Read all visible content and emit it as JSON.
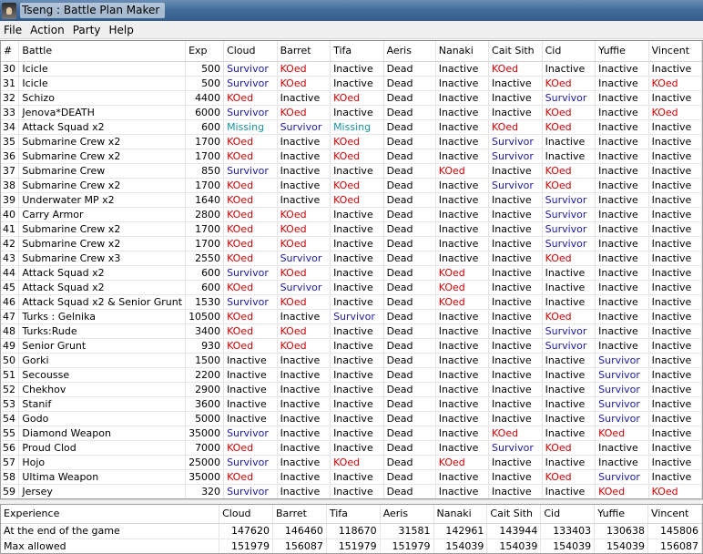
{
  "window": {
    "title": "Tseng : Battle Plan Maker"
  },
  "menu": [
    "File",
    "Action",
    "Party",
    "Help"
  ],
  "battle_grid": {
    "headers": [
      "#",
      "Battle",
      "Exp",
      "Cloud",
      "Barret",
      "Tifa",
      "Aeris",
      "Nanaki",
      "Cait Sith",
      "Cid",
      "Yuffie",
      "Vincent"
    ],
    "rows": [
      [
        "30",
        "Icicle",
        "500",
        "Survivor",
        "KOed",
        "Inactive",
        "Dead",
        "Inactive",
        "KOed",
        "Inactive",
        "Inactive",
        "Inactive"
      ],
      [
        "31",
        "Icicle",
        "500",
        "Survivor",
        "KOed",
        "Inactive",
        "Dead",
        "Inactive",
        "Inactive",
        "KOed",
        "Inactive",
        "KOed"
      ],
      [
        "32",
        "Schizo",
        "4400",
        "KOed",
        "Inactive",
        "KOed",
        "Dead",
        "Inactive",
        "Inactive",
        "Survivor",
        "Inactive",
        "Inactive"
      ],
      [
        "33",
        "Jenova*DEATH",
        "6000",
        "Survivor",
        "KOed",
        "Inactive",
        "Dead",
        "Inactive",
        "Inactive",
        "KOed",
        "Inactive",
        "KOed"
      ],
      [
        "34",
        "Attack Squad x2",
        "600",
        "Missing",
        "Survivor",
        "Missing",
        "Dead",
        "Inactive",
        "KOed",
        "KOed",
        "Inactive",
        "Inactive"
      ],
      [
        "35",
        "Submarine Crew x2",
        "1700",
        "KOed",
        "Inactive",
        "KOed",
        "Dead",
        "Inactive",
        "Survivor",
        "Inactive",
        "Inactive",
        "Inactive"
      ],
      [
        "36",
        "Submarine Crew x2",
        "1700",
        "KOed",
        "Inactive",
        "KOed",
        "Dead",
        "Inactive",
        "Survivor",
        "Inactive",
        "Inactive",
        "Inactive"
      ],
      [
        "37",
        "Submarine Crew",
        "850",
        "Survivor",
        "Inactive",
        "Inactive",
        "Dead",
        "KOed",
        "Inactive",
        "KOed",
        "Inactive",
        "Inactive"
      ],
      [
        "38",
        "Submarine Crew x2",
        "1700",
        "KOed",
        "Inactive",
        "KOed",
        "Dead",
        "Inactive",
        "Survivor",
        "KOed",
        "Inactive",
        "Inactive"
      ],
      [
        "39",
        "Underwater MP x2",
        "1640",
        "KOed",
        "Inactive",
        "KOed",
        "Dead",
        "Inactive",
        "Inactive",
        "Survivor",
        "Inactive",
        "Inactive"
      ],
      [
        "40",
        "Carry Armor",
        "2800",
        "KOed",
        "KOed",
        "Inactive",
        "Dead",
        "Inactive",
        "Inactive",
        "Survivor",
        "Inactive",
        "Inactive"
      ],
      [
        "41",
        "Submarine Crew x2",
        "1700",
        "KOed",
        "KOed",
        "Inactive",
        "Dead",
        "Inactive",
        "Inactive",
        "Survivor",
        "Inactive",
        "Inactive"
      ],
      [
        "42",
        "Submarine Crew x2",
        "1700",
        "KOed",
        "KOed",
        "Inactive",
        "Dead",
        "Inactive",
        "Inactive",
        "Survivor",
        "Inactive",
        "Inactive"
      ],
      [
        "43",
        "Submarine Crew x3",
        "2550",
        "KOed",
        "Survivor",
        "Inactive",
        "Dead",
        "Inactive",
        "Inactive",
        "KOed",
        "Inactive",
        "Inactive"
      ],
      [
        "44",
        "Attack Squad x2",
        "600",
        "Survivor",
        "KOed",
        "Inactive",
        "Dead",
        "KOed",
        "Inactive",
        "Inactive",
        "Inactive",
        "Inactive"
      ],
      [
        "45",
        "Attack Squad x2",
        "600",
        "KOed",
        "Survivor",
        "Inactive",
        "Dead",
        "KOed",
        "Inactive",
        "Inactive",
        "Inactive",
        "Inactive"
      ],
      [
        "46",
        "Attack Squad x2 & Senior Grunt",
        "1530",
        "Survivor",
        "KOed",
        "Inactive",
        "Dead",
        "KOed",
        "Inactive",
        "Inactive",
        "Inactive",
        "Inactive"
      ],
      [
        "47",
        "Turks : Gelnika",
        "10500",
        "KOed",
        "Inactive",
        "Survivor",
        "Dead",
        "Inactive",
        "Inactive",
        "KOed",
        "Inactive",
        "Inactive"
      ],
      [
        "48",
        "Turks:Rude",
        "3400",
        "KOed",
        "KOed",
        "Inactive",
        "Dead",
        "Inactive",
        "Inactive",
        "Survivor",
        "Inactive",
        "Inactive"
      ],
      [
        "49",
        "Senior Grunt",
        "930",
        "KOed",
        "KOed",
        "Inactive",
        "Dead",
        "Inactive",
        "Inactive",
        "Survivor",
        "Inactive",
        "Inactive"
      ],
      [
        "50",
        "Gorki",
        "1500",
        "Inactive",
        "Inactive",
        "Inactive",
        "Dead",
        "Inactive",
        "Inactive",
        "Inactive",
        "Survivor",
        "Inactive"
      ],
      [
        "51",
        "Secousse",
        "2200",
        "Inactive",
        "Inactive",
        "Inactive",
        "Dead",
        "Inactive",
        "Inactive",
        "Inactive",
        "Survivor",
        "Inactive"
      ],
      [
        "52",
        "Chekhov",
        "2900",
        "Inactive",
        "Inactive",
        "Inactive",
        "Dead",
        "Inactive",
        "Inactive",
        "Inactive",
        "Survivor",
        "Inactive"
      ],
      [
        "53",
        "Stanif",
        "3600",
        "Inactive",
        "Inactive",
        "Inactive",
        "Dead",
        "Inactive",
        "Inactive",
        "Inactive",
        "Survivor",
        "Inactive"
      ],
      [
        "54",
        "Godo",
        "5000",
        "Inactive",
        "Inactive",
        "Inactive",
        "Dead",
        "Inactive",
        "Inactive",
        "Inactive",
        "Survivor",
        "Inactive"
      ],
      [
        "55",
        "Diamond Weapon",
        "35000",
        "Survivor",
        "Inactive",
        "Inactive",
        "Dead",
        "Inactive",
        "KOed",
        "Inactive",
        "KOed",
        "Inactive"
      ],
      [
        "56",
        "Proud Clod",
        "7000",
        "KOed",
        "Inactive",
        "Inactive",
        "Dead",
        "Inactive",
        "Survivor",
        "KOed",
        "Inactive",
        "Inactive"
      ],
      [
        "57",
        "Hojo",
        "25000",
        "Survivor",
        "Inactive",
        "KOed",
        "Dead",
        "KOed",
        "Inactive",
        "Inactive",
        "Inactive",
        "Inactive"
      ],
      [
        "58",
        "Ultima Weapon",
        "35000",
        "KOed",
        "Inactive",
        "Inactive",
        "Dead",
        "Inactive",
        "Inactive",
        "KOed",
        "Survivor",
        "Inactive"
      ],
      [
        "59",
        "Jersey",
        "320",
        "Survivor",
        "Inactive",
        "Inactive",
        "Dead",
        "Inactive",
        "Inactive",
        "Inactive",
        "KOed",
        "KOed"
      ]
    ]
  },
  "experience_grid": {
    "headers": [
      "Experience",
      "Cloud",
      "Barret",
      "Tifa",
      "Aeris",
      "Nanaki",
      "Cait Sith",
      "Cid",
      "Yuffie",
      "Vincent"
    ],
    "rows": [
      [
        "At the end of the game",
        "147620",
        "146460",
        "118670",
        "31581",
        "142961",
        "143944",
        "133403",
        "130638",
        "145806"
      ],
      [
        "Max allowed",
        "151979",
        "156087",
        "151979",
        "151979",
        "154039",
        "154039",
        "154039",
        "154039",
        "156087"
      ]
    ]
  },
  "status_colors": {
    "Survivor": "#1a1aa8",
    "KOed": "#d00000",
    "Missing": "#1a8fa0",
    "Inactive": "#000000",
    "Dead": "#000000"
  }
}
